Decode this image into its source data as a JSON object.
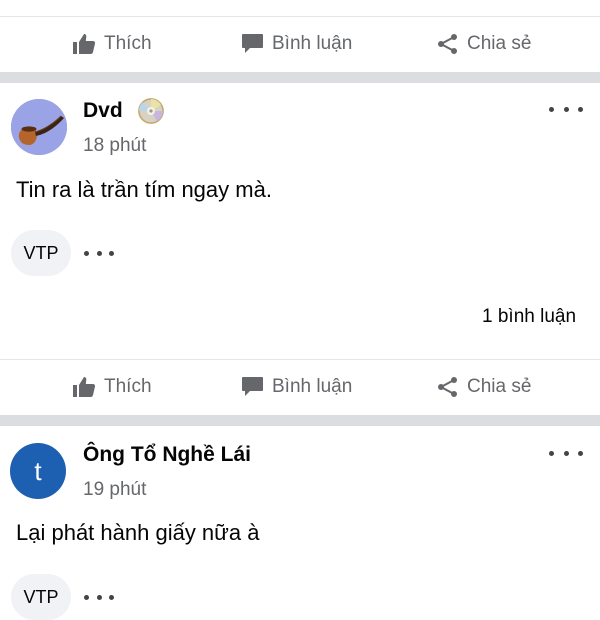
{
  "actions": {
    "like": "Thích",
    "comment": "Bình luận",
    "share": "Chia sẻ"
  },
  "posts": [
    {
      "author": "Dvd",
      "author_badge_icon": "cd-disc-icon",
      "avatar_icon": "smoking-pipe-icon",
      "time": "18 phút",
      "text": "Tin ra là trần tím ngay mà.",
      "chip": "VTP",
      "comment_count": "1 bình luận"
    },
    {
      "author": "Ông Tổ Nghề Lái",
      "avatar_letter": "t",
      "avatar_color": "#1d5fb0",
      "time": "19 phút",
      "text": "Lại phát hành giấy nữa à",
      "chip": "VTP"
    }
  ]
}
